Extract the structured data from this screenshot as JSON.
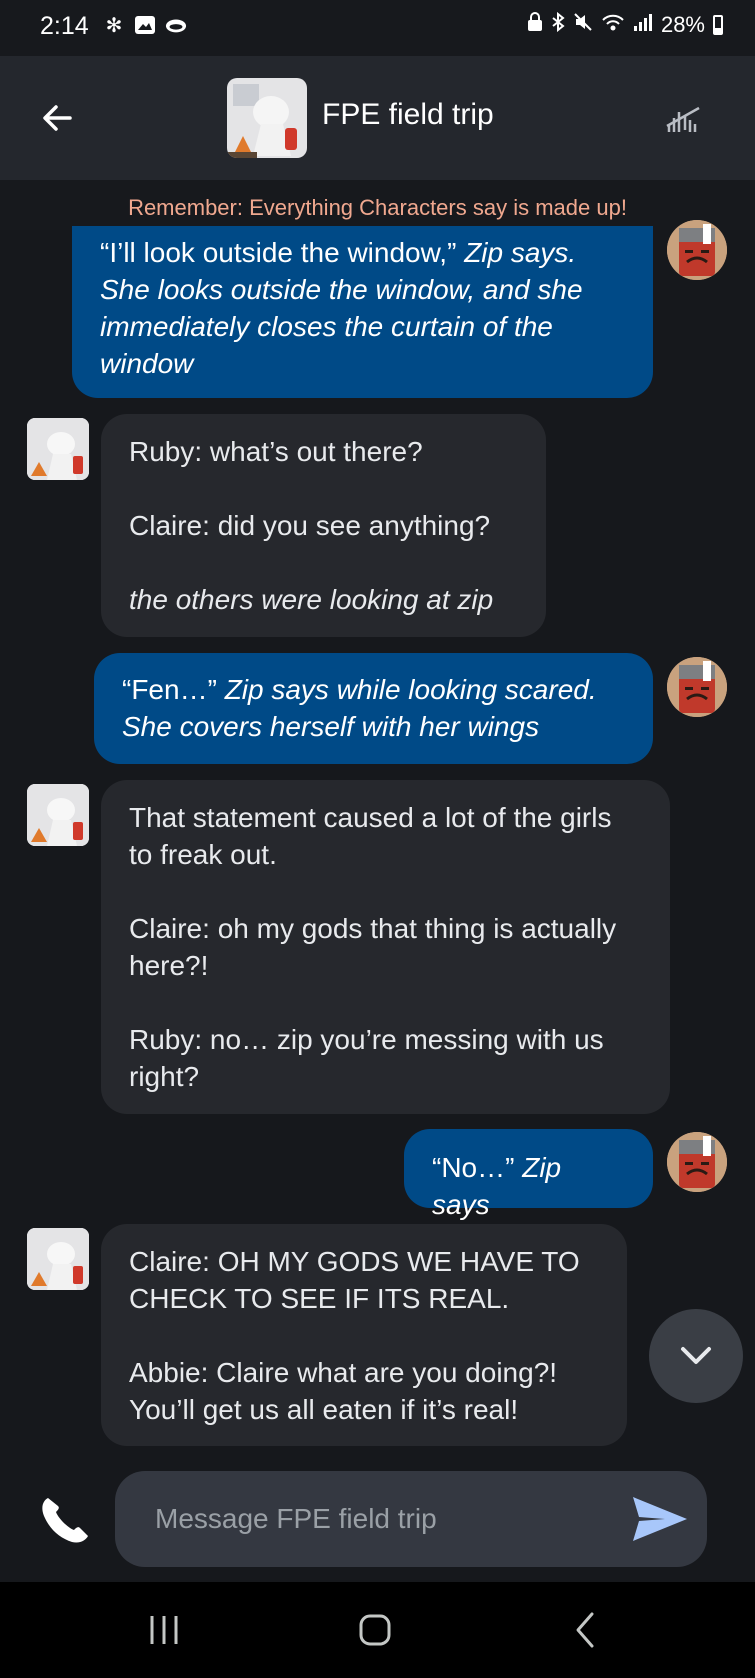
{
  "status_bar": {
    "time": "2:14",
    "battery": "28%"
  },
  "header": {
    "title": "FPE field trip"
  },
  "disclaimer": "Remember: Everything Characters say is made up!",
  "messages": [
    {
      "role": "user",
      "text": "“I’ll look outside the window,”",
      "italic": "Zip says. She looks outside the window, and she immediately closes the curtain of the window"
    },
    {
      "role": "bot",
      "lines": [
        "Ruby: what’s out there?",
        "Claire: did you see anything?"
      ],
      "italic": "the others were looking at zip"
    },
    {
      "role": "user",
      "text": "“Fen…”",
      "italic": "Zip says while looking scared. She covers herself with her wings"
    },
    {
      "role": "bot",
      "lines": [
        "That statement caused a lot of the girls to freak out.",
        "Claire: oh my gods that thing is actually here?!",
        "Ruby: no… zip you’re messing with us right?"
      ]
    },
    {
      "role": "user",
      "text": "“No…”",
      "italic": "Zip says"
    },
    {
      "role": "bot",
      "lines": [
        "Claire: OH MY GODS WE HAVE TO CHECK TO SEE IF ITS REAL.",
        "Abbie: Claire what are you doing?! You’ll get us all eaten if it’s real!"
      ]
    }
  ],
  "composer": {
    "placeholder": "Message FPE field trip"
  },
  "icons": {
    "back": "arrow-left-icon",
    "history": "history-icon",
    "phone": "phone-icon",
    "send": "send-icon",
    "scroll_down": "chevron-down-icon"
  },
  "colors": {
    "user_bubble": "#004a87",
    "bot_bubble": "#26282d",
    "disclaimer_text": "#f0a88f",
    "send_accent": "#a8c7fa"
  }
}
